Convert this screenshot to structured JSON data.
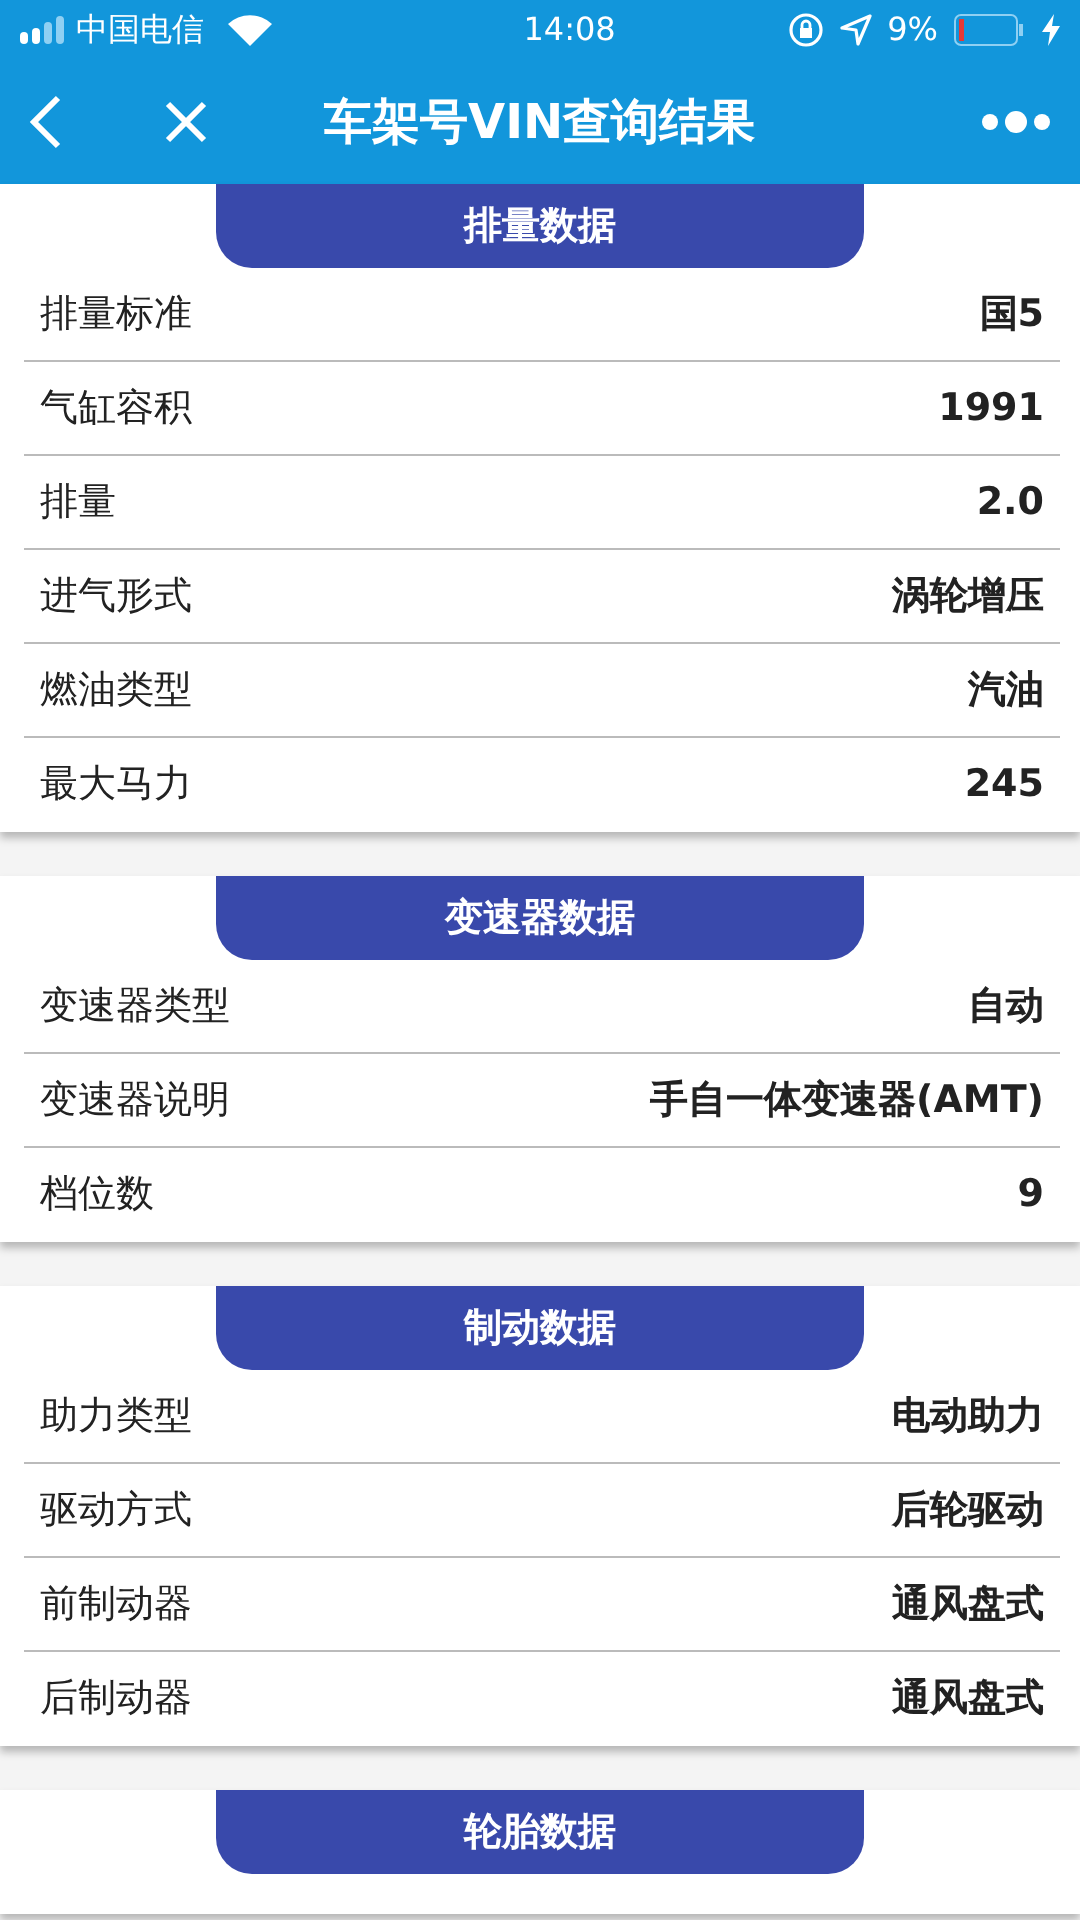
{
  "status_bar": {
    "carrier": "中国电信",
    "time": "14:08",
    "battery": "9%"
  },
  "nav": {
    "title": "车架号VIN查询结果"
  },
  "sections": [
    {
      "title": "排量数据",
      "rows": [
        {
          "label": "排量标准",
          "value": "国5"
        },
        {
          "label": "气缸容积",
          "value": "1991"
        },
        {
          "label": "排量",
          "value": "2.0"
        },
        {
          "label": "进气形式",
          "value": "涡轮增压"
        },
        {
          "label": "燃油类型",
          "value": "汽油"
        },
        {
          "label": "最大马力",
          "value": "245"
        }
      ]
    },
    {
      "title": "变速器数据",
      "rows": [
        {
          "label": "变速器类型",
          "value": "自动"
        },
        {
          "label": "变速器说明",
          "value": "手自一体变速器(AMT)"
        },
        {
          "label": "档位数",
          "value": "9"
        }
      ]
    },
    {
      "title": "制动数据",
      "rows": [
        {
          "label": "助力类型",
          "value": "电动助力"
        },
        {
          "label": "驱动方式",
          "value": "后轮驱动"
        },
        {
          "label": "前制动器",
          "value": "通风盘式"
        },
        {
          "label": "后制动器",
          "value": "通风盘式"
        }
      ]
    },
    {
      "title": "轮胎数据"
    }
  ]
}
